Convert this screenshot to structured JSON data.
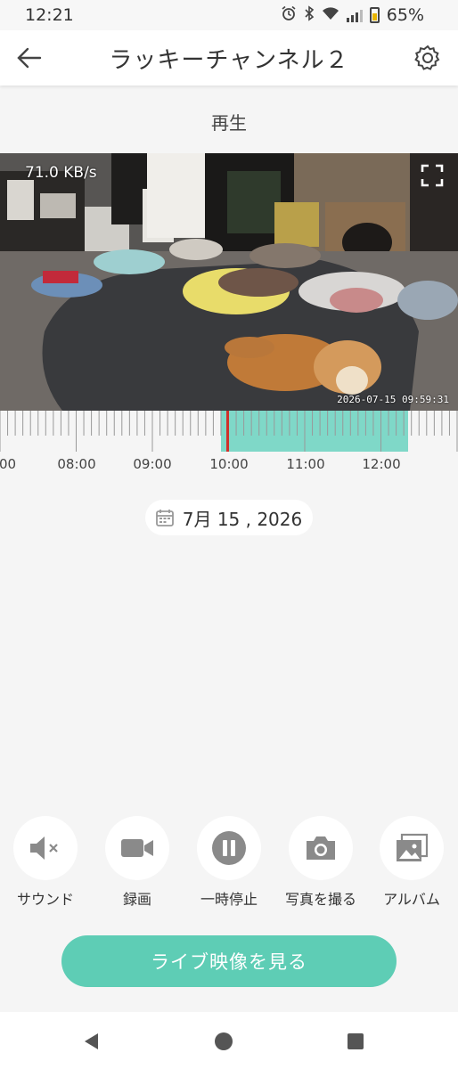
{
  "status_bar": {
    "time": "12:21",
    "battery": "65%",
    "icons": [
      "alarm-icon",
      "bluetooth-icon",
      "wifi-icon",
      "signal-icon",
      "battery-icon"
    ]
  },
  "header": {
    "title": "ラッキーチャンネル２",
    "back_icon": "arrow-left-icon",
    "settings_icon": "gear-icon"
  },
  "section_label": "再生",
  "video": {
    "bitrate": "71.0 KB/s",
    "timestamp": "2026-07-15  09:59:31",
    "fullscreen_icon": "fullscreen-icon"
  },
  "timeline": {
    "labels": [
      ":00",
      "08:00",
      "09:00",
      "10:00",
      "11:00",
      "12:00"
    ],
    "recorded_color": "#7fd8c8",
    "playhead_color": "#d0302a"
  },
  "date": {
    "text": "7月 15 , 2026",
    "icon": "calendar-icon"
  },
  "controls": [
    {
      "label": "サウンド",
      "icon": "sound-muted-icon"
    },
    {
      "label": "録画",
      "icon": "video-camera-icon"
    },
    {
      "label": "一時停止",
      "icon": "pause-icon"
    },
    {
      "label": "写真を撮る",
      "icon": "camera-icon"
    },
    {
      "label": "アルバム",
      "icon": "album-icon"
    }
  ],
  "live_button": "ライブ映像を見る",
  "nav": [
    "back-triangle-icon",
    "home-circle-icon",
    "recents-square-icon"
  ],
  "colors": {
    "accent": "#5ecdb5",
    "icon_gray": "#8a8a8a"
  }
}
